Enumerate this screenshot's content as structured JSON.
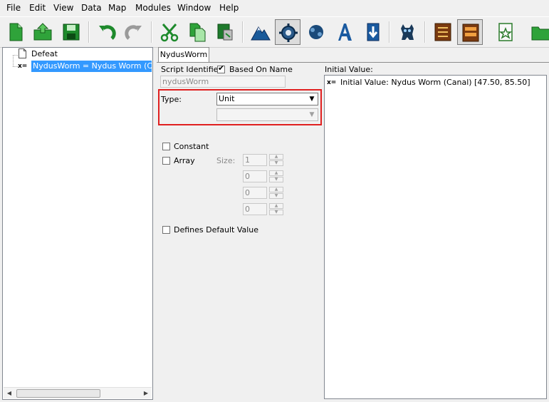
{
  "menu": [
    "File",
    "Edit",
    "View",
    "Data",
    "Map",
    "Modules",
    "Window",
    "Help"
  ],
  "tree": {
    "items": [
      {
        "label": "Defeat",
        "icon": "page-icon"
      },
      {
        "label": "NydusWorm = Nydus Worm (Canal)",
        "icon": "variable-icon",
        "icon_text": "x=",
        "selected": true
      }
    ]
  },
  "tabs": [
    "NydusWorm"
  ],
  "form": {
    "script_identifier_label": "Script Identifier:",
    "based_on_name_label": "Based On Name",
    "based_on_name_checked": true,
    "script_identifier_value": "nydusWorm",
    "type_label": "Type:",
    "type_value": "Unit",
    "subtype_value": "",
    "constant_label": "Constant",
    "array_label": "Array",
    "size_label": "Size:",
    "size_values": [
      "1",
      "0",
      "0",
      "0"
    ],
    "defines_default_label": "Defines Default Value",
    "initial_value_label": "Initial Value:",
    "initial_value_item": "Initial Value: Nydus Worm (Canal) [47.50, 85.50]",
    "initial_value_icon_text": "x="
  },
  "colors": {
    "highlight": "#e02020",
    "selection": "#3399ff"
  }
}
